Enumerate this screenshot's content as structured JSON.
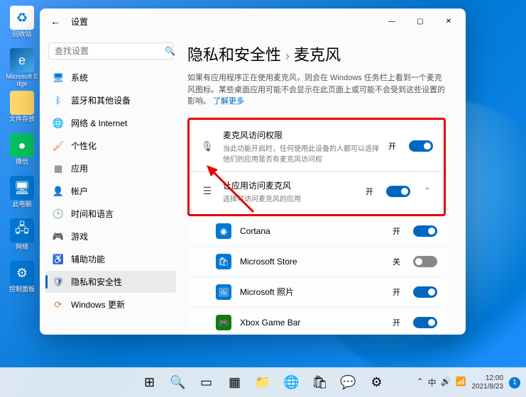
{
  "desktop": {
    "icons": [
      {
        "name": "recycle-bin",
        "label": "回收站",
        "cls": "recycle",
        "glyph": "♻"
      },
      {
        "name": "edge",
        "label": "Microsoft Edge",
        "cls": "edge",
        "glyph": "e"
      },
      {
        "name": "folder-docs",
        "label": "文件存放",
        "cls": "folder",
        "glyph": ""
      },
      {
        "name": "wechat",
        "label": "微信",
        "cls": "wechat",
        "glyph": "●"
      },
      {
        "name": "this-pc",
        "label": "此电脑",
        "cls": "pc",
        "glyph": "🖥"
      },
      {
        "name": "network",
        "label": "网络",
        "cls": "net",
        "glyph": "🖧"
      },
      {
        "name": "control-panel",
        "label": "控制面板",
        "cls": "ctrl",
        "glyph": "⚙"
      }
    ]
  },
  "window": {
    "title": "设置",
    "search_placeholder": "查找设置",
    "nav": [
      {
        "icon": "🖥",
        "label": "系统",
        "color": "#0078d4"
      },
      {
        "icon": "ᛒ",
        "label": "蓝牙和其他设备",
        "color": "#0078d4"
      },
      {
        "icon": "🌐",
        "label": "网络 & Internet",
        "color": "#5aa457"
      },
      {
        "icon": "🖌",
        "label": "个性化",
        "color": "#d17a3a"
      },
      {
        "icon": "▦",
        "label": "应用",
        "color": "#666"
      },
      {
        "icon": "👤",
        "label": "帐户",
        "color": "#5a8ad1"
      },
      {
        "icon": "🕒",
        "label": "时间和语言",
        "color": "#4aa3a3"
      },
      {
        "icon": "🎮",
        "label": "游戏",
        "color": "#666"
      },
      {
        "icon": "♿",
        "label": "辅助功能",
        "color": "#3a6fb0"
      },
      {
        "icon": "🛡",
        "label": "隐私和安全性",
        "color": "#4a6aa5",
        "active": true
      },
      {
        "icon": "⟳",
        "label": "Windows 更新",
        "color": "#d17a3a"
      }
    ],
    "breadcrumb": {
      "parent": "隐私和安全性",
      "current": "麦克风"
    },
    "description": "如果有应用程序正在使用麦克风，则会在 Windows 任务栏上看到一个麦克风图标。某些桌面应用可能不会显示在此页面上或可能不会受到这些设置的影响。",
    "learn_more": "了解更多",
    "settings": [
      {
        "icon": "🎙",
        "title": "麦克风访问权限",
        "sub": "当此功能开启时，任何使用此设备的人都可以选择他们的应用是否有麦克风访问权",
        "state": "开",
        "on": true
      },
      {
        "icon": "☰",
        "title": "让应用访问麦克风",
        "sub": "选择可访问麦克风的应用",
        "state": "开",
        "on": true,
        "expand": true
      }
    ],
    "apps": [
      {
        "name": "Cortana",
        "color": "#0078d4",
        "glyph": "◉",
        "state": "开",
        "on": true
      },
      {
        "name": "Microsoft Store",
        "color": "#0078d4",
        "glyph": "🛍",
        "state": "关",
        "on": false
      },
      {
        "name": "Microsoft 照片",
        "color": "#0078d4",
        "glyph": "🖼",
        "state": "开",
        "on": true
      },
      {
        "name": "Xbox Game Bar",
        "color": "#107c10",
        "glyph": "🎮",
        "state": "开",
        "on": true
      }
    ]
  },
  "taskbar": {
    "icons": [
      "start",
      "search",
      "tasks",
      "widgets",
      "explorer",
      "edge",
      "store",
      "wechat",
      "settings"
    ],
    "tray": [
      "⌃",
      "中",
      "🔊",
      "📶"
    ],
    "time": "12:00",
    "date": "2021/8/23"
  }
}
